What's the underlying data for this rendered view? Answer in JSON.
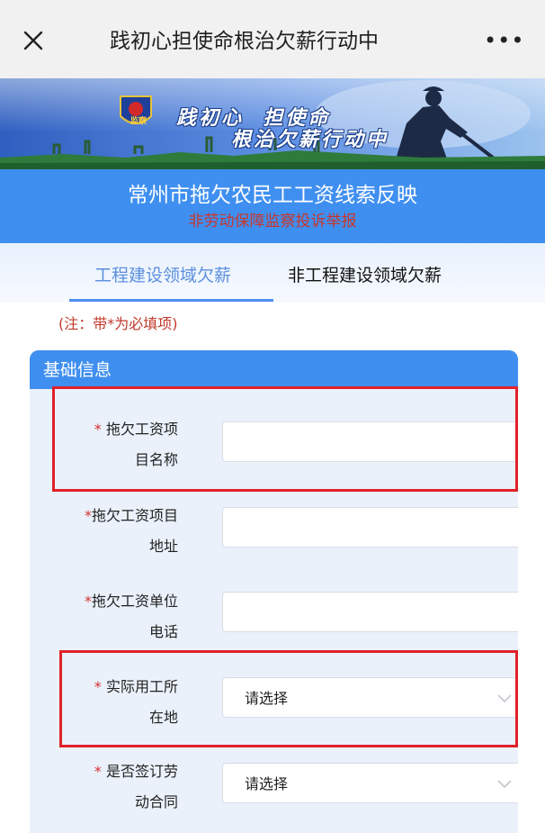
{
  "navbar": {
    "title": "践初心担使命根治欠薪行动中",
    "close_icon": "close-icon",
    "more_label": "•••"
  },
  "banner": {
    "line1": "践初心  担使命",
    "line2": "根治欠薪行动中",
    "badge_text": "监察"
  },
  "header": {
    "title": "常州市拖欠农民工工资线索反映",
    "subtitle": "非劳动保障监察投诉举报"
  },
  "tabs": [
    {
      "label": "工程建设领域欠薪",
      "active": true
    },
    {
      "label": "非工程建设领域欠薪",
      "active": false
    }
  ],
  "note": "(注：带*为必填项)",
  "form": {
    "section_title": "基础信息",
    "fields": [
      {
        "line1": "拖欠工资项",
        "line2": "目名称",
        "star": "* ",
        "type": "input",
        "value": ""
      },
      {
        "line1": "拖欠工资项目",
        "line2": "地址",
        "star": "*",
        "type": "input",
        "value": ""
      },
      {
        "line1": "拖欠工资单位",
        "line2": "电话",
        "star": "*",
        "type": "input",
        "value": ""
      },
      {
        "line1": "实际用工所",
        "line2": "在地",
        "star": "* ",
        "type": "select",
        "value": "请选择"
      },
      {
        "line1": "是否签订劳",
        "line2": "动合同",
        "star": "* ",
        "type": "select",
        "value": "请选择"
      }
    ]
  },
  "colors": {
    "primary_blue": "#3f8ff0",
    "required_red": "#d43030",
    "highlight_red": "#e0212a",
    "active_tab": "#5b8fde"
  }
}
